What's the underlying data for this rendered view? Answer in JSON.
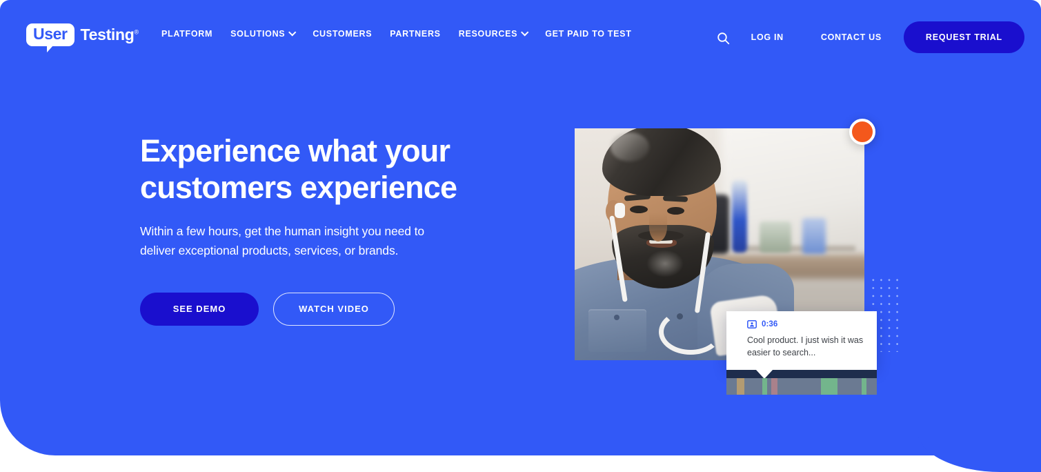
{
  "colors": {
    "hero_bg": "#3259F7",
    "deep_blue": "#1A0FCE",
    "accent_orange": "#F4581C",
    "white": "#FFFFFF",
    "timeline_dark": "#1E2D4D",
    "timeline_track": "#6B7A92"
  },
  "logo": {
    "bubble_text": "User",
    "word": "Testing",
    "trademark": "®"
  },
  "nav": {
    "items": [
      {
        "label": "PLATFORM",
        "has_dropdown": false,
        "icon": ""
      },
      {
        "label": "SOLUTIONS",
        "has_dropdown": true,
        "icon": "chevron-down-icon"
      },
      {
        "label": "CUSTOMERS",
        "has_dropdown": false,
        "icon": ""
      },
      {
        "label": "PARTNERS",
        "has_dropdown": false,
        "icon": ""
      },
      {
        "label": "RESOURCES",
        "has_dropdown": true,
        "icon": "chevron-down-icon"
      },
      {
        "label": "GET PAID TO TEST",
        "has_dropdown": false,
        "icon": ""
      }
    ],
    "search_icon": "search-icon",
    "login_label": "LOG IN",
    "contact_label": "CONTACT US",
    "trial_button_label": "REQUEST TRIAL"
  },
  "hero": {
    "headline_line1": "Experience what your",
    "headline_line2": "customers experience",
    "subhead_line1": "Within a few hours, get the human insight you need to",
    "subhead_line2": "deliver exceptional products, services, or brands.",
    "primary_cta": "SEE DEMO",
    "secondary_cta": "WATCH VIDEO"
  },
  "media": {
    "record_indicator": "record-dot",
    "photo_alt": "Man with beard wearing white earbuds in a kitchen",
    "quote_card": {
      "avatar_icon": "participant-avatar-icon",
      "timestamp": "0:36",
      "text": "Cool product. I just wish it was easier to search..."
    },
    "timeline": {
      "playhead_position_pct": 25,
      "segments": [
        {
          "left_pct": 7,
          "width_pct": 5,
          "color": "#B39B72"
        },
        {
          "left_pct": 24,
          "width_pct": 3,
          "color": "#73B58C"
        },
        {
          "left_pct": 30,
          "width_pct": 4,
          "color": "#A9818B"
        },
        {
          "left_pct": 63,
          "width_pct": 11,
          "color": "#73B58C"
        },
        {
          "left_pct": 90,
          "width_pct": 3,
          "color": "#73B58C"
        }
      ]
    }
  }
}
